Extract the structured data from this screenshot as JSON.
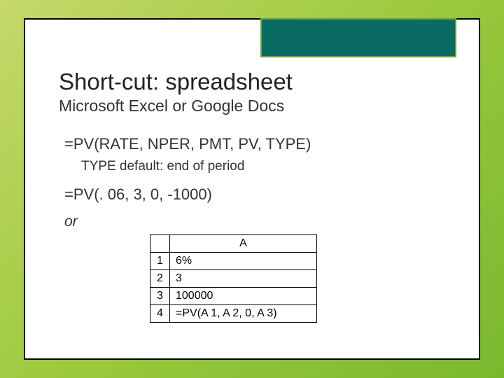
{
  "title": "Short-cut: spreadsheet",
  "subtitle": "Microsoft Excel or Google Docs",
  "formula_syntax": "=PV(RATE, NPER, PMT, PV, TYPE)",
  "type_note": "TYPE default: end of period",
  "formula_example": "=PV(. 06, 3, 0, -1000)",
  "or_label": "or",
  "table": {
    "col_header": "A",
    "rows": [
      {
        "num": "1",
        "val": "6%"
      },
      {
        "num": "2",
        "val": "3"
      },
      {
        "num": "3",
        "val": "100000"
      },
      {
        "num": "4",
        "val": "=PV(A 1, A 2, 0, A 3)"
      }
    ]
  }
}
